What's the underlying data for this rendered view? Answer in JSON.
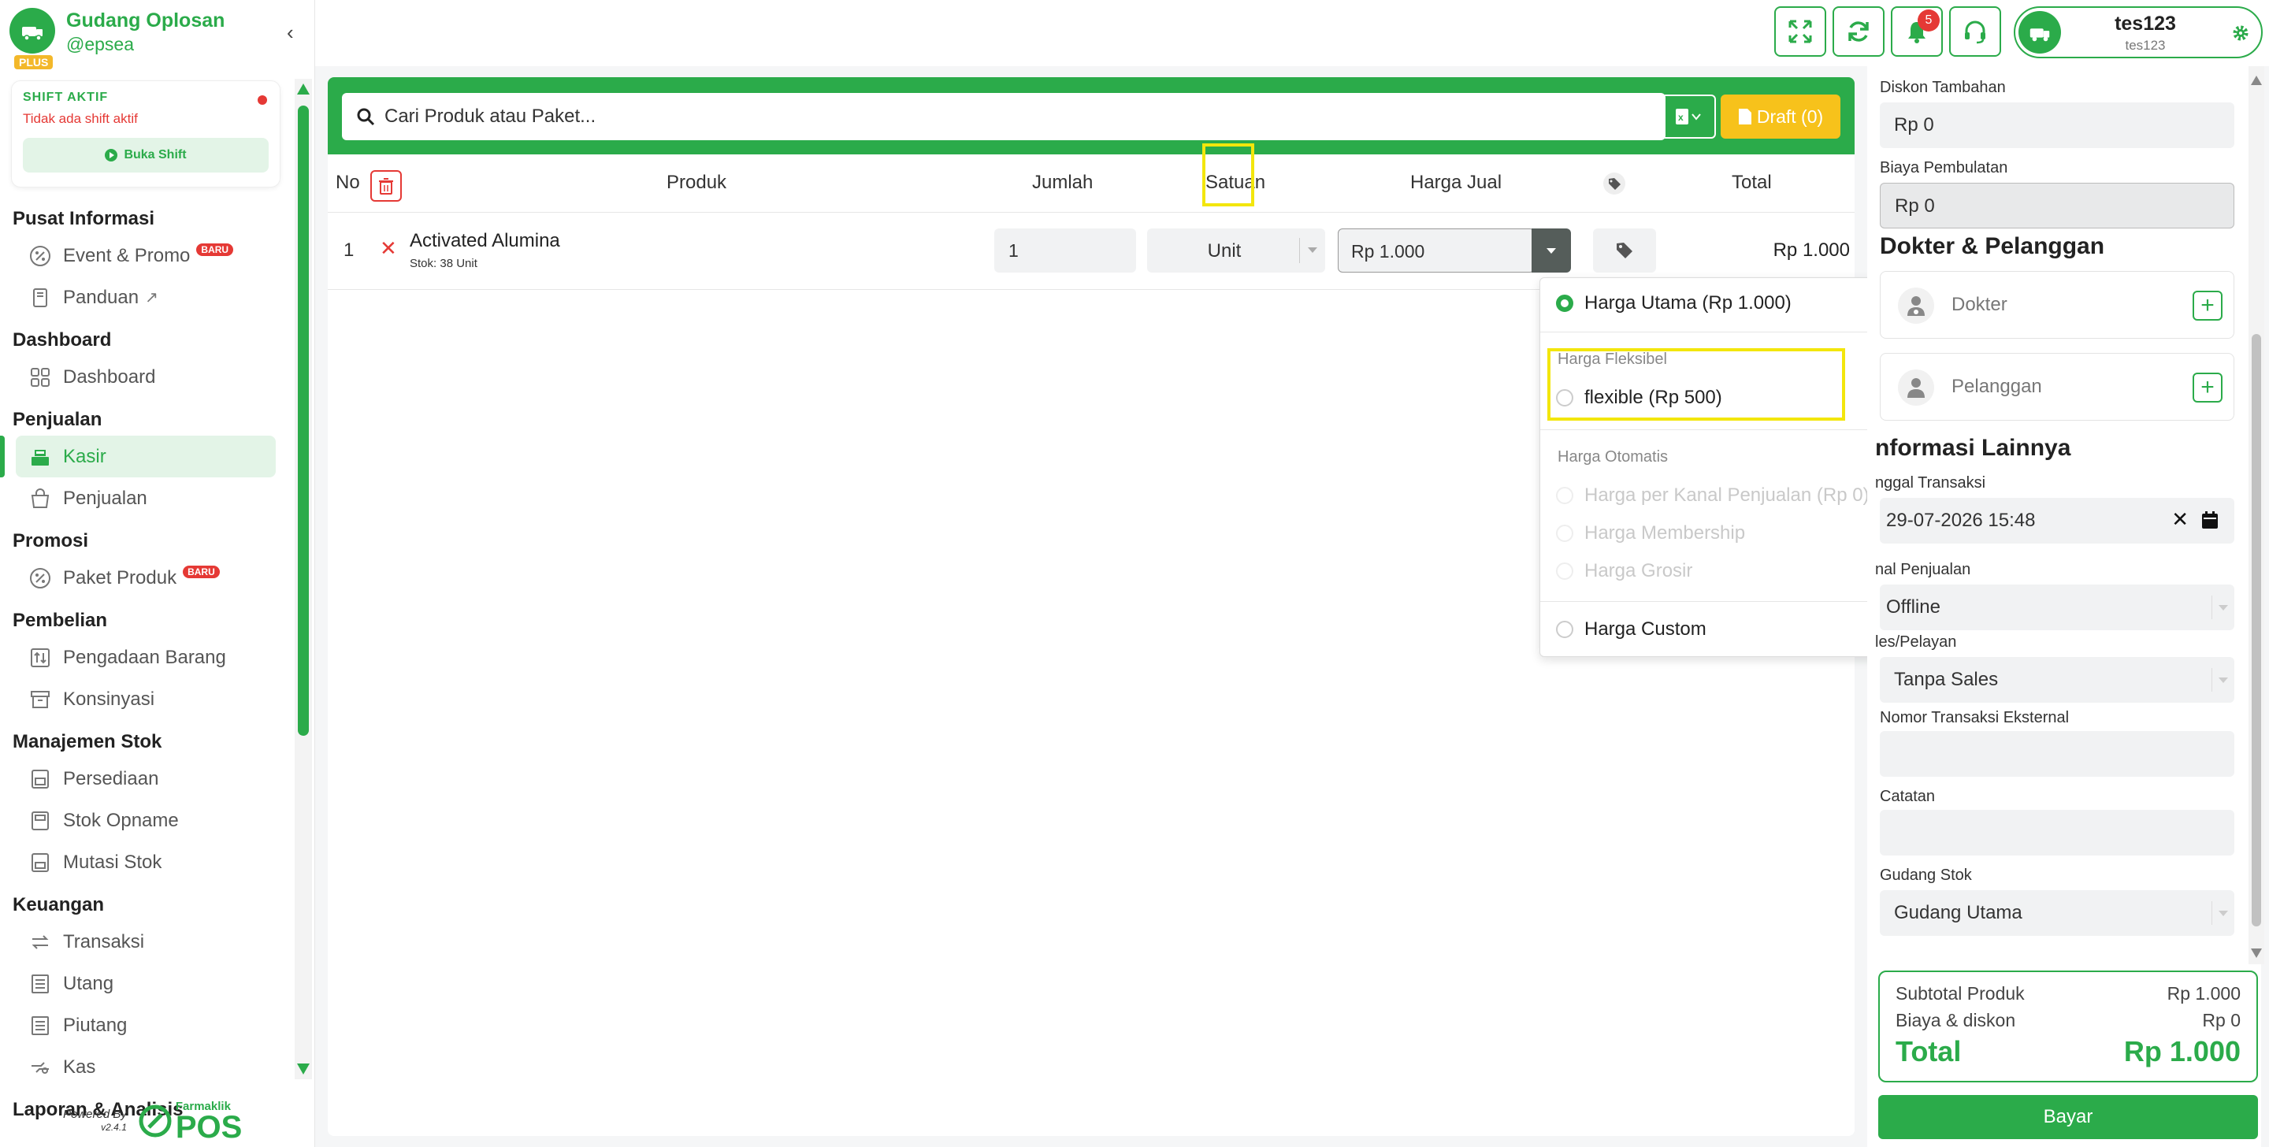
{
  "brand": {
    "name": "Gudang Oplosan",
    "handle": "@epsea",
    "plan": "PLUS"
  },
  "shift": {
    "title": "SHIFT AKTIF",
    "status": "Tidak ada shift aktif",
    "button": "Buka Shift"
  },
  "nav": {
    "sections": [
      {
        "title": "Pusat Informasi",
        "items": [
          {
            "label": "Event & Promo",
            "icon": "percent-icon",
            "badge": "BARU"
          },
          {
            "label": "Panduan",
            "icon": "book-icon",
            "external": true
          }
        ]
      },
      {
        "title": "Dashboard",
        "items": [
          {
            "label": "Dashboard",
            "icon": "grid-icon"
          }
        ]
      },
      {
        "title": "Penjualan",
        "items": [
          {
            "label": "Kasir",
            "icon": "cash-register-icon",
            "active": true
          },
          {
            "label": "Penjualan",
            "icon": "shopping-bag-icon"
          }
        ]
      },
      {
        "title": "Promosi",
        "items": [
          {
            "label": "Paket Produk",
            "icon": "percent-icon",
            "badge": "BARU"
          }
        ]
      },
      {
        "title": "Pembelian",
        "items": [
          {
            "label": "Pengadaan Barang",
            "icon": "procurement-icon"
          },
          {
            "label": "Konsinyasi",
            "icon": "box-icon"
          }
        ]
      },
      {
        "title": "Manajemen Stok",
        "items": [
          {
            "label": "Persediaan",
            "icon": "inventory-icon"
          },
          {
            "label": "Stok Opname",
            "icon": "stock-opname-icon"
          },
          {
            "label": "Mutasi Stok",
            "icon": "stock-transfer-icon"
          }
        ]
      },
      {
        "title": "Keuangan",
        "items": [
          {
            "label": "Transaksi",
            "icon": "exchange-icon"
          },
          {
            "label": "Utang",
            "icon": "ledger-icon"
          },
          {
            "label": "Piutang",
            "icon": "ledger-icon"
          },
          {
            "label": "Kas",
            "icon": "cash-icon"
          }
        ]
      },
      {
        "title": "Laporan & Analisis",
        "items": []
      }
    ]
  },
  "powered": {
    "by": "Powered By",
    "version": "v2.4.1",
    "brand_small": "Farmaklik",
    "brand_big": "POS"
  },
  "topbar": {
    "notif_count": "5",
    "user_name": "tes123",
    "user_sub": "tes123"
  },
  "search": {
    "placeholder": "Cari Produk atau Paket..."
  },
  "draft": {
    "label": "Draft (0)"
  },
  "table": {
    "headers": {
      "no": "No",
      "product": "Produk",
      "qty": "Jumlah",
      "unit": "Satuan",
      "price": "Harga Jual",
      "total": "Total"
    },
    "rows": [
      {
        "no": "1",
        "name": "Activated Alumina",
        "stock": "Stok: 38 Unit",
        "qty": "1",
        "unit": "Unit",
        "price": "Rp 1.000",
        "total": "Rp 1.000"
      }
    ]
  },
  "price_menu": {
    "main": "Harga Utama (Rp 1.000)",
    "flex_group": "Harga Fleksibel",
    "flex_option": "flexible (Rp 500)",
    "auto_group": "Harga Otomatis",
    "auto_options": [
      "Harga per Kanal Penjualan (Rp 0)",
      "Harga Membership",
      "Harga Grosir"
    ],
    "custom": "Harga Custom"
  },
  "right": {
    "diskon_label": "Diskon Tambahan",
    "diskon_value": "Rp 0",
    "pembulatan_label": "Biaya Pembulatan",
    "pembulatan_value": "Rp 0",
    "dokter_heading": "Dokter & Pelanggan",
    "dokter": "Dokter",
    "pelanggan": "Pelanggan",
    "info_heading": "nformasi Lainnya",
    "tanggal_label": "nggal Transaksi",
    "tanggal_value": "29-07-2026 15:48",
    "kanal_label": "nal Penjualan",
    "kanal_value": "Offline",
    "sales_label": "les/Pelayan",
    "sales_value": "Tanpa Sales",
    "nomor_label": "Nomor Transaksi Eksternal",
    "nomor_value": "",
    "catatan_label": "Catatan",
    "catatan_value": "",
    "gudang_label": "Gudang Stok",
    "gudang_value": "Gudang Utama"
  },
  "summary": {
    "subtotal_label": "Subtotal Produk",
    "subtotal_value": "Rp 1.000",
    "biaya_label": "Biaya & diskon",
    "biaya_value": "Rp 0",
    "total_label": "Total",
    "total_value": "Rp 1.000",
    "pay_button": "Bayar"
  },
  "colors": {
    "primary": "#2bab4a",
    "danger": "#e53935",
    "warning": "#f7c21b",
    "highlight": "#f3e60c"
  }
}
